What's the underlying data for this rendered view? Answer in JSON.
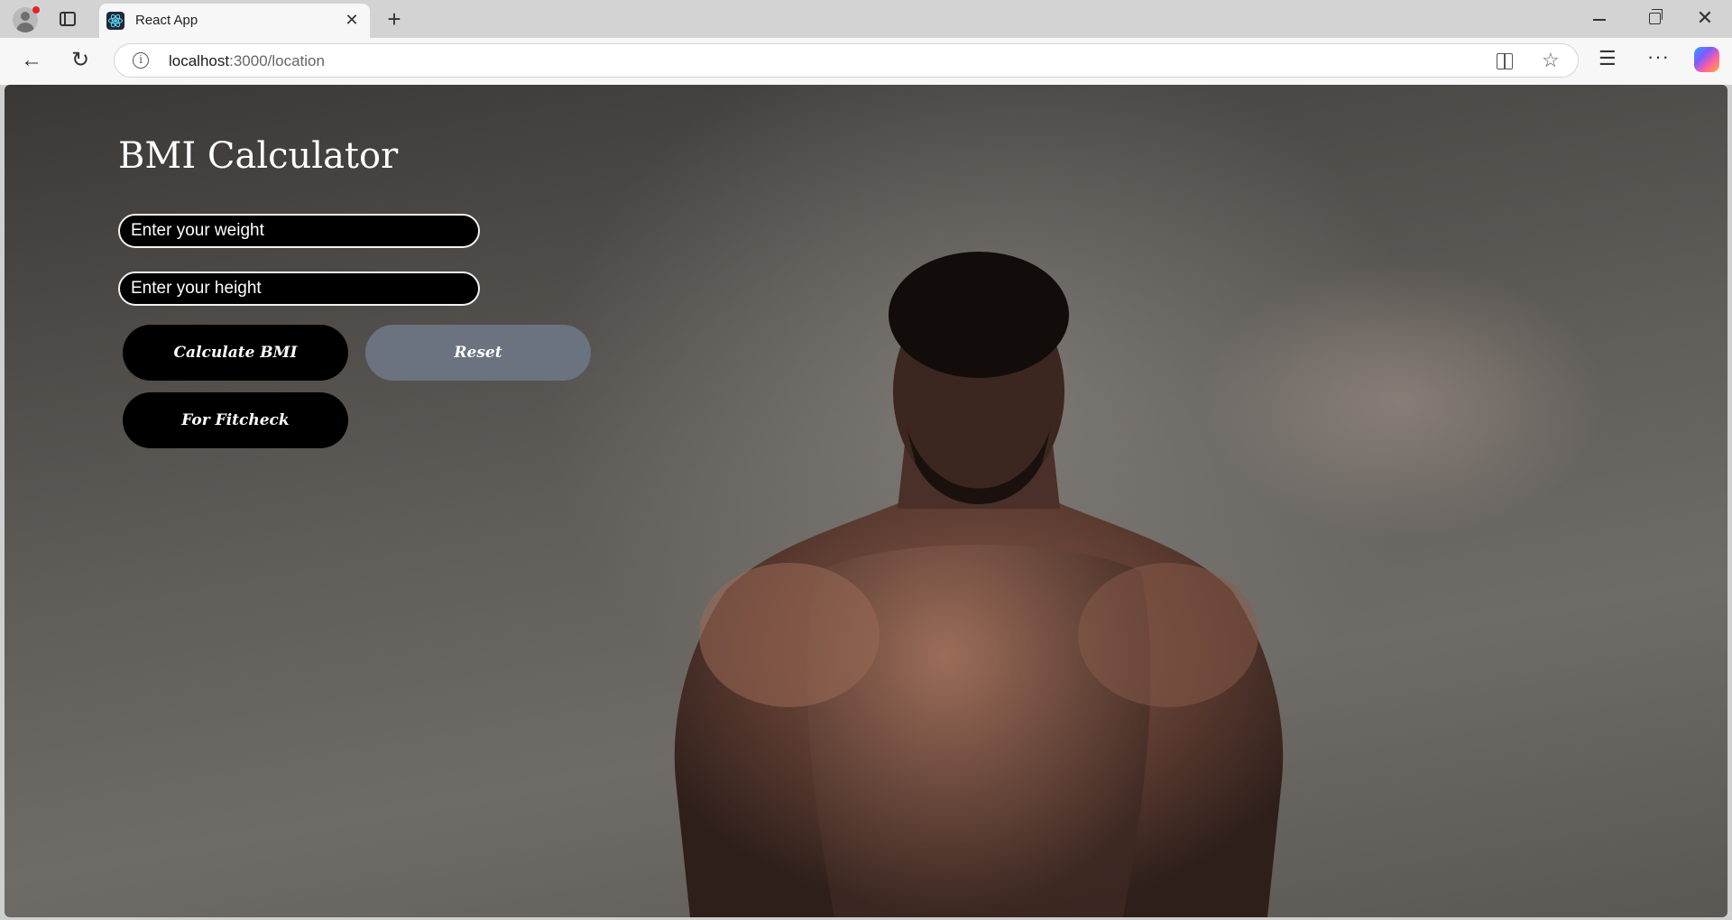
{
  "browser": {
    "tab_title": "React App",
    "url_host": "localhost",
    "url_path": ":3000/location",
    "icons": {
      "profile": "profile-avatar-icon",
      "tabs": "tab-actions-icon",
      "favicon": "react-logo-icon",
      "close_tab": "close-icon",
      "new_tab": "plus-icon",
      "back": "arrow-left-icon",
      "reload": "reload-icon",
      "site_info": "info-icon",
      "split_screen": "split-screen-icon",
      "favorite": "star-icon",
      "favorites_list": "favorites-icon",
      "more": "more-icon",
      "copilot": "copilot-icon",
      "minimize": "minimize-icon",
      "restore": "restore-icon",
      "close_window": "close-icon"
    },
    "glyphs": {
      "close": "✕",
      "plus": "+",
      "back": "←",
      "reload": "↻",
      "info": "i",
      "star": "☆",
      "favorites": "☰",
      "more": "···"
    }
  },
  "page": {
    "title": "BMI Calculator",
    "weight_placeholder": "Enter your weight",
    "height_placeholder": "Enter your height",
    "calculate_label": "Calculate BMI",
    "reset_label": "Reset",
    "fitcheck_label": "For Fitcheck"
  },
  "colors": {
    "primary_button": "#000000",
    "reset_button": "#6b7280",
    "text": "#ffffff"
  }
}
